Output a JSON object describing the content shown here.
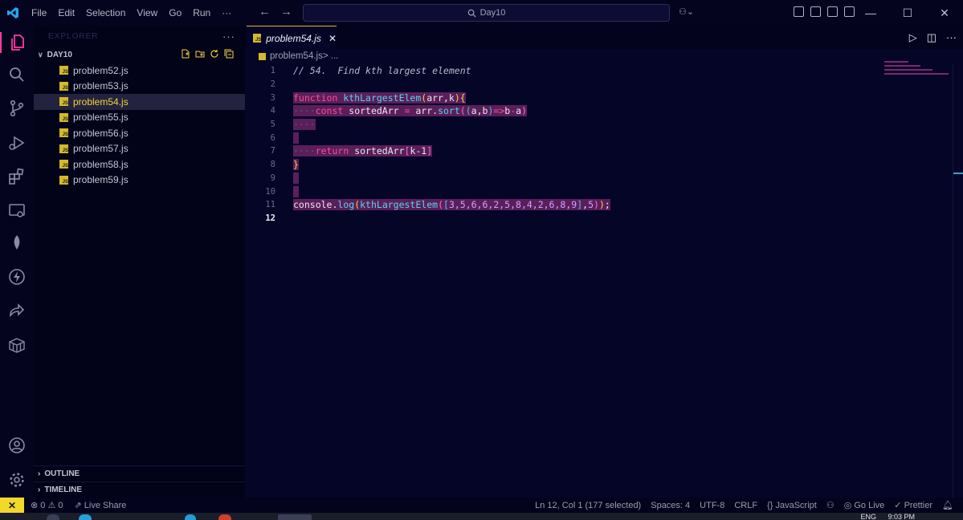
{
  "menu": [
    "File",
    "Edit",
    "Selection",
    "View",
    "Go",
    "Run",
    "···"
  ],
  "search": {
    "text": "Day10"
  },
  "sidebar": {
    "header": "EXPLORER",
    "more": "···",
    "folder": "DAY10",
    "files": [
      {
        "name": "problem52.js"
      },
      {
        "name": "problem53.js"
      },
      {
        "name": "problem54.js",
        "active": true
      },
      {
        "name": "problem55.js"
      },
      {
        "name": "problem56.js"
      },
      {
        "name": "problem57.js"
      },
      {
        "name": "problem58.js"
      },
      {
        "name": "problem59.js"
      }
    ],
    "sections": [
      "OUTLINE",
      "TIMELINE"
    ]
  },
  "tab": {
    "label": "problem54.js",
    "close": "✕",
    "badge": "JS"
  },
  "breadcrumb": {
    "file": "problem54.js",
    "sep": " > ..."
  },
  "code": {
    "line1": "// 54.  Find kth largest element",
    "l3_kw": "function",
    "l3_fn": "kthLargestElem",
    "l3_params": "arr,k",
    "l4_kw": "const",
    "l4_var": "sortedArr",
    "l4_obj": "arr",
    "l4_method": "sort",
    "l4_a": "a",
    "l4_b": "b",
    "l7_kw": "return",
    "l7_var": "sortedArr",
    "l7_idx": "k-1",
    "l11_obj": "console",
    "l11_method": "log",
    "l11_fn": "kthLargestElem",
    "l11_array": "3,5,6,6,2,5,8,4,2,6,8,9",
    "l11_k": "5"
  },
  "status": {
    "errors": "0",
    "warnings": "0",
    "live_share": "Live Share",
    "position": "Ln 12, Col 1 (177 selected)",
    "spaces": "Spaces: 4",
    "encoding": "UTF-8",
    "eol": "CRLF",
    "language": "JavaScript",
    "golive": "Go Live",
    "prettier": "Prettier"
  },
  "tray": {
    "lang": "ENG",
    "time": "9:03 PM"
  },
  "colors": {
    "accent": "#f5d33a",
    "keyword": "#ff4a9a",
    "function": "#55d4f0",
    "selection": "#5a1f5a"
  }
}
